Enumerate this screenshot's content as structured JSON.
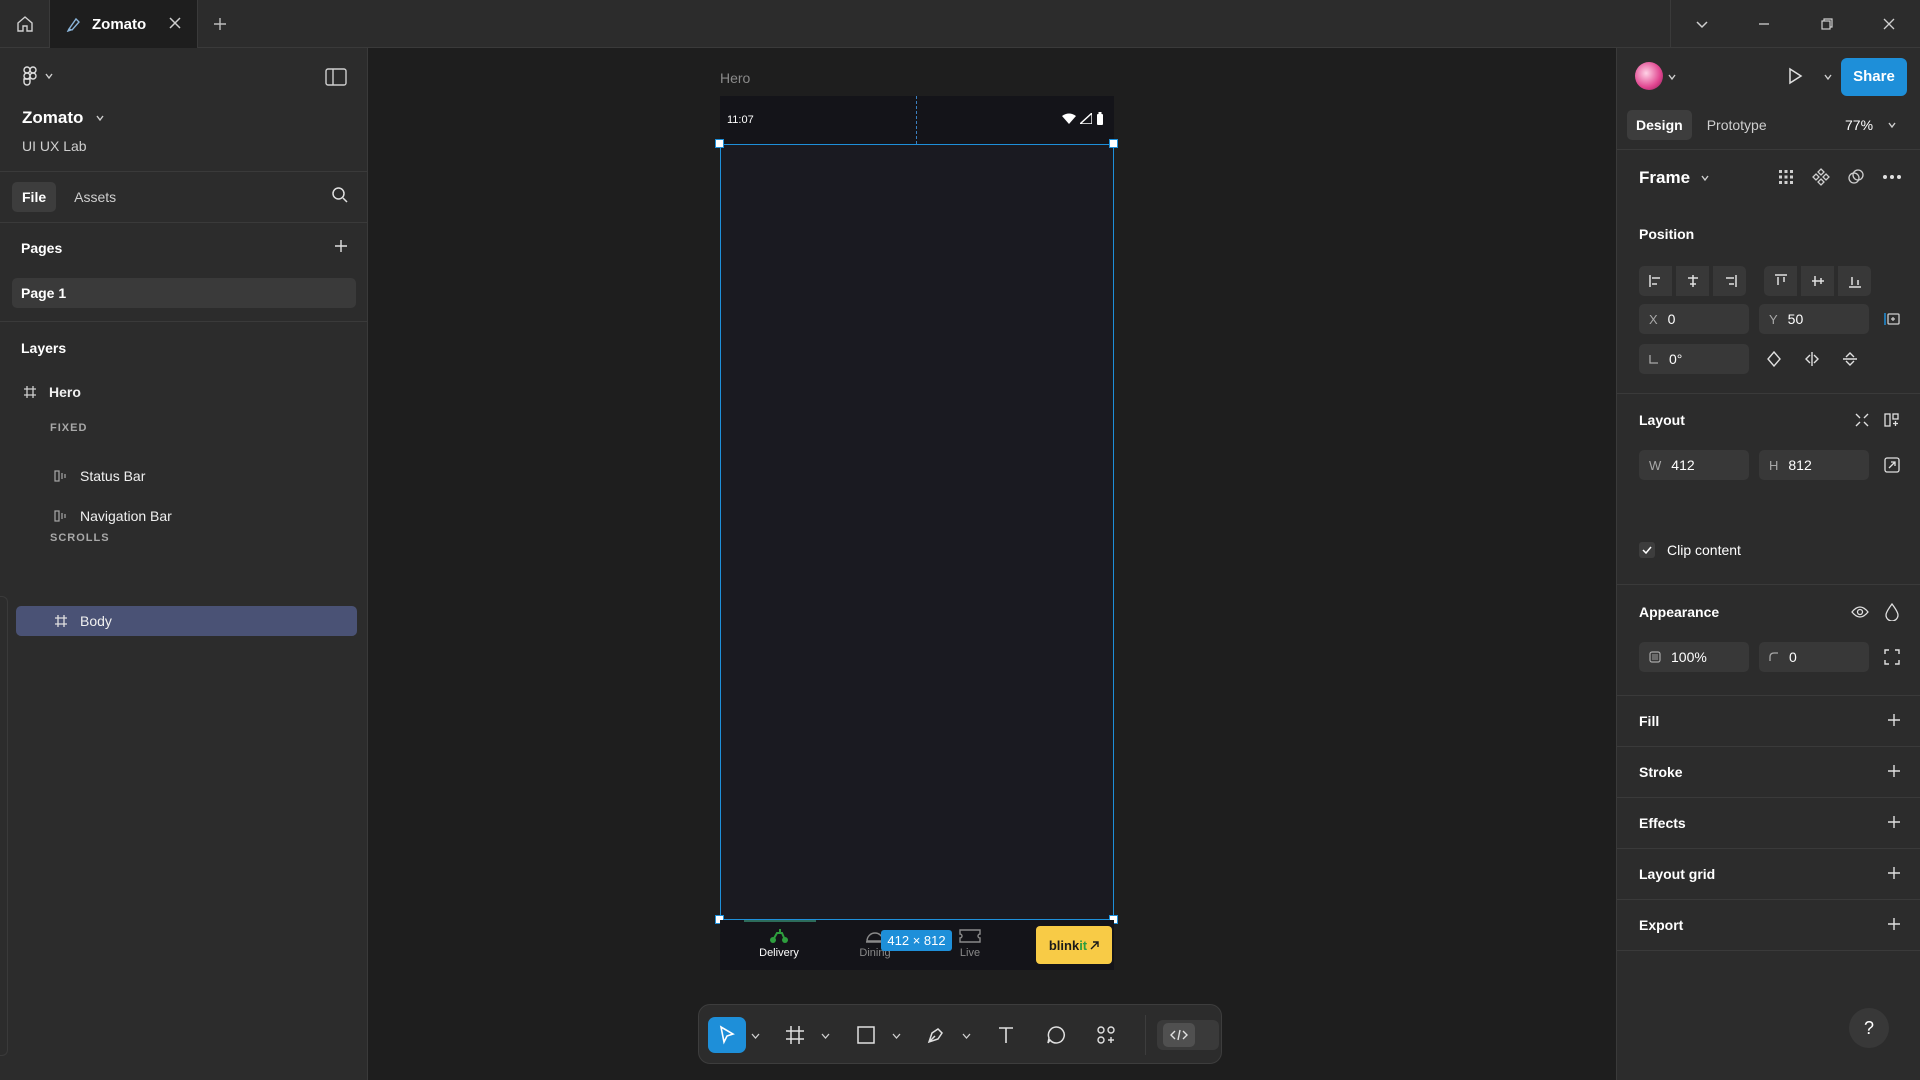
{
  "titlebar": {
    "tab_title": "Zomato"
  },
  "file": {
    "project_name": "Zomato",
    "team_name": "UI UX Lab",
    "tabs": [
      "File",
      "Assets"
    ]
  },
  "pages": {
    "title": "Pages",
    "items": [
      "Page 1"
    ]
  },
  "layers": {
    "title": "Layers",
    "root": "Hero",
    "fixed_caption": "FIXED",
    "fixed_items": [
      "Status Bar",
      "Navigation Bar"
    ],
    "scrolls_caption": "SCROLLS",
    "scrolls_items": [
      "Body"
    ]
  },
  "canvas": {
    "frame_label": "Hero",
    "status_time": "11:07",
    "nav_items": [
      "Delivery",
      "Dining",
      "Live"
    ],
    "blinkit_text_a": "blink",
    "blinkit_text_b": "it",
    "size_badge": "412 × 812"
  },
  "design_panel": {
    "share_label": "Share",
    "tabs": [
      "Design",
      "Prototype"
    ],
    "zoom": "77%",
    "frame_type": "Frame",
    "position": {
      "title": "Position",
      "x_label": "X",
      "x": "0",
      "y_label": "Y",
      "y": "50",
      "rotation": "0°"
    },
    "layout": {
      "title": "Layout",
      "w_label": "W",
      "w": "412",
      "h_label": "H",
      "h": "812",
      "clip_content": "Clip content"
    },
    "appearance": {
      "title": "Appearance",
      "opacity": "100%",
      "radius": "0"
    },
    "sections": [
      "Fill",
      "Stroke",
      "Effects",
      "Layout grid",
      "Export"
    ]
  },
  "help_label": "?",
  "colors": {
    "accent": "#1e8fd9",
    "selection": "#4a5275",
    "blinkit": "#f8cb46",
    "delivery_green": "#2e9e3e"
  }
}
